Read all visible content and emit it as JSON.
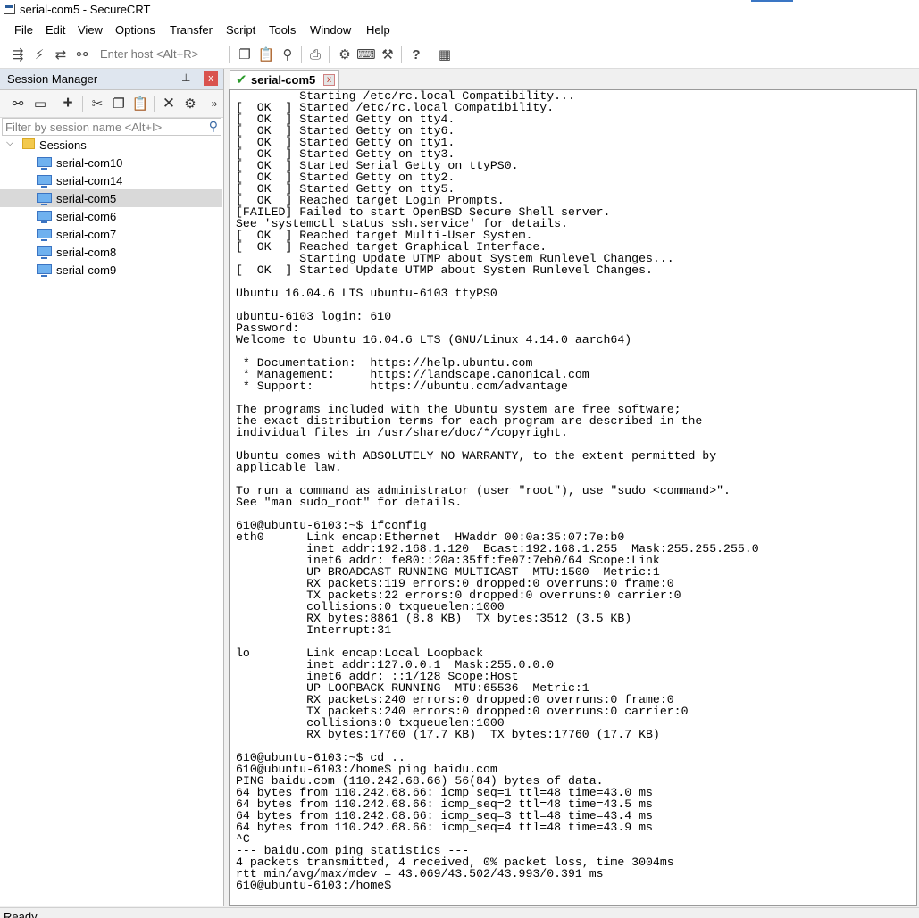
{
  "window": {
    "title": "serial-com5 - SecureCRT"
  },
  "menu": [
    "File",
    "Edit",
    "View",
    "Options",
    "Transfer",
    "Script",
    "Tools",
    "Window",
    "Help"
  ],
  "toolbar": {
    "host_placeholder": "Enter host <Alt+R>",
    "icons": [
      "connect-icon",
      "quick-connect-icon",
      "reconnect-icon",
      "disconnect-icon",
      "copy-icon",
      "paste-icon",
      "find-icon",
      "print-icon",
      "session-options-icon",
      "keymap-icon",
      "sftp-icon",
      "help-icon",
      "screenshot-icon"
    ]
  },
  "session_manager": {
    "title": "Session Manager",
    "pin_glyph": "📌",
    "close_glyph": "x",
    "filter_placeholder": "Filter by session name <Alt+I>",
    "root_folder": "Sessions",
    "sessions": [
      "serial-com10",
      "serial-com14",
      "serial-com5",
      "serial-com6",
      "serial-com7",
      "serial-com8",
      "serial-com9"
    ],
    "selected": "serial-com5"
  },
  "tabs": [
    {
      "label": "serial-com5",
      "close": "x",
      "status_color": "#2c9b2c"
    }
  ],
  "terminal": {
    "lines": [
      "         Starting /etc/rc.local Compatibility...",
      "[  OK  ] Started /etc/rc.local Compatibility.",
      "[  OK  ] Started Getty on tty4.",
      "[  OK  ] Started Getty on tty6.",
      "[  OK  ] Started Getty on tty1.",
      "[  OK  ] Started Getty on tty3.",
      "[  OK  ] Started Serial Getty on ttyPS0.",
      "[  OK  ] Started Getty on tty2.",
      "[  OK  ] Started Getty on tty5.",
      "[  OK  ] Reached target Login Prompts.",
      "[FAILED] Failed to start OpenBSD Secure Shell server.",
      "See 'systemctl status ssh.service' for details.",
      "[  OK  ] Reached target Multi-User System.",
      "[  OK  ] Reached target Graphical Interface.",
      "         Starting Update UTMP about System Runlevel Changes...",
      "[  OK  ] Started Update UTMP about System Runlevel Changes.",
      "",
      "Ubuntu 16.04.6 LTS ubuntu-6103 ttyPS0",
      "",
      "ubuntu-6103 login: 610",
      "Password:",
      "Welcome to Ubuntu 16.04.6 LTS (GNU/Linux 4.14.0 aarch64)",
      "",
      " * Documentation:  https://help.ubuntu.com",
      " * Management:     https://landscape.canonical.com",
      " * Support:        https://ubuntu.com/advantage",
      "",
      "The programs included with the Ubuntu system are free software;",
      "the exact distribution terms for each program are described in the",
      "individual files in /usr/share/doc/*/copyright.",
      "",
      "Ubuntu comes with ABSOLUTELY NO WARRANTY, to the extent permitted by",
      "applicable law.",
      "",
      "To run a command as administrator (user \"root\"), use \"sudo <command>\".",
      "See \"man sudo_root\" for details.",
      "",
      "610@ubuntu-6103:~$ ifconfig",
      "eth0      Link encap:Ethernet  HWaddr 00:0a:35:07:7e:b0",
      "          inet addr:192.168.1.120  Bcast:192.168.1.255  Mask:255.255.255.0",
      "          inet6 addr: fe80::20a:35ff:fe07:7eb0/64 Scope:Link",
      "          UP BROADCAST RUNNING MULTICAST  MTU:1500  Metric:1",
      "          RX packets:119 errors:0 dropped:0 overruns:0 frame:0",
      "          TX packets:22 errors:0 dropped:0 overruns:0 carrier:0",
      "          collisions:0 txqueuelen:1000",
      "          RX bytes:8861 (8.8 KB)  TX bytes:3512 (3.5 KB)",
      "          Interrupt:31",
      "",
      "lo        Link encap:Local Loopback",
      "          inet addr:127.0.0.1  Mask:255.0.0.0",
      "          inet6 addr: ::1/128 Scope:Host",
      "          UP LOOPBACK RUNNING  MTU:65536  Metric:1",
      "          RX packets:240 errors:0 dropped:0 overruns:0 frame:0",
      "          TX packets:240 errors:0 dropped:0 overruns:0 carrier:0",
      "          collisions:0 txqueuelen:1000",
      "          RX bytes:17760 (17.7 KB)  TX bytes:17760 (17.7 KB)",
      "",
      "610@ubuntu-6103:~$ cd ..",
      "610@ubuntu-6103:/home$ ping baidu.com",
      "PING baidu.com (110.242.68.66) 56(84) bytes of data.",
      "64 bytes from 110.242.68.66: icmp_seq=1 ttl=48 time=43.0 ms",
      "64 bytes from 110.242.68.66: icmp_seq=2 ttl=48 time=43.5 ms",
      "64 bytes from 110.242.68.66: icmp_seq=3 ttl=48 time=43.4 ms",
      "64 bytes from 110.242.68.66: icmp_seq=4 ttl=48 time=43.9 ms",
      "^C",
      "--- baidu.com ping statistics ---",
      "4 packets transmitted, 4 received, 0% packet loss, time 3004ms",
      "rtt min/avg/max/mdev = 43.069/43.502/43.993/0.391 ms",
      "610@ubuntu-6103:/home$ "
    ]
  },
  "status_bar": {
    "text": "Ready"
  },
  "colors": {
    "accent": "#3a76c4",
    "panel_header": "#dfe6ef",
    "selected_row": "#d9d9d9",
    "close_red": "#d9534f"
  }
}
